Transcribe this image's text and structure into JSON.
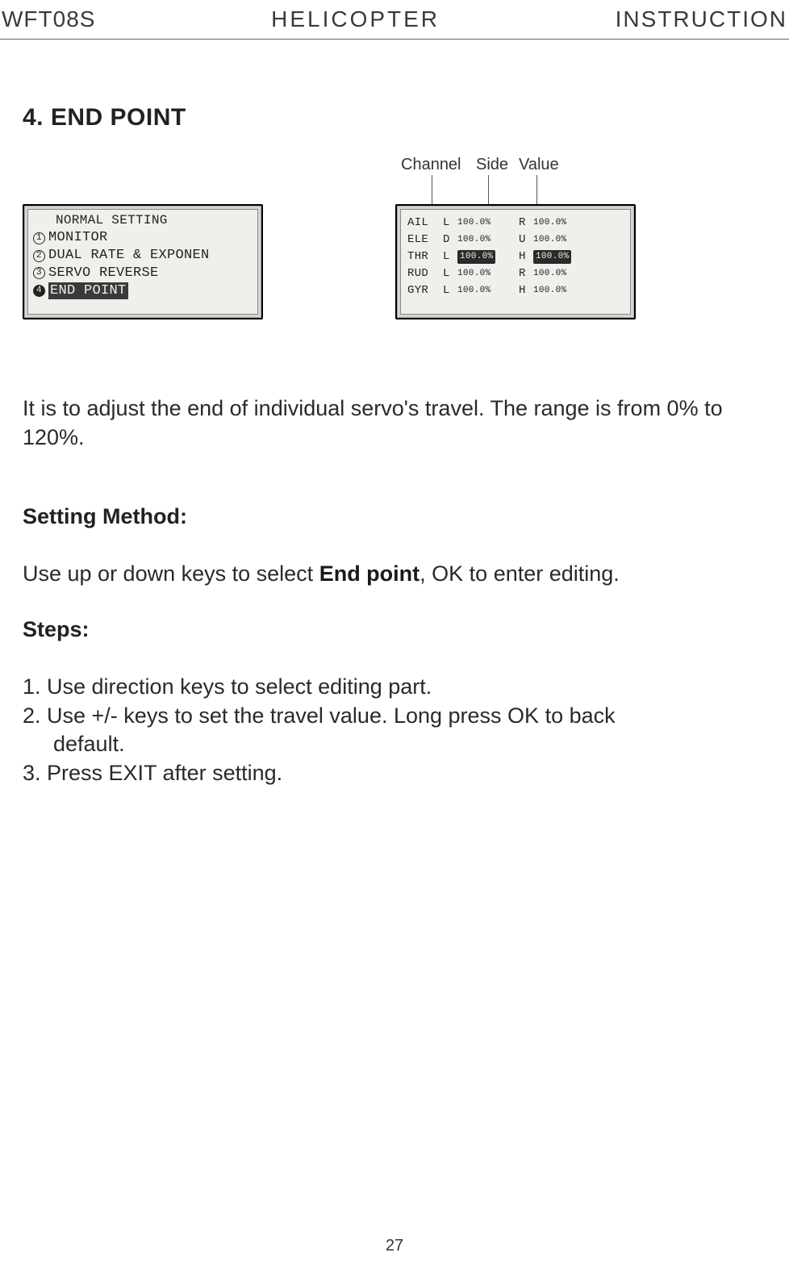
{
  "header": {
    "left": "WFT08S",
    "center": "HELICOPTER",
    "right": "INSTRUCTION"
  },
  "section_title": "4. END POINT",
  "callouts": {
    "channel": "Channel",
    "side": "Side",
    "value": "Value"
  },
  "lcd_menu": {
    "title": "NORMAL SETTING",
    "items": [
      {
        "num": "1",
        "label": "MONITOR"
      },
      {
        "num": "2",
        "label": "DUAL RATE & EXPONEN"
      },
      {
        "num": "3",
        "label": "SERVO REVERSE"
      },
      {
        "num": "4",
        "label": "END POINT",
        "selected": true
      }
    ]
  },
  "endpoint_table": {
    "rows": [
      {
        "ch": "AIL",
        "s1": "L",
        "v1": "100.0%",
        "s2": "R",
        "v2": "100.0%",
        "hl": false
      },
      {
        "ch": "ELE",
        "s1": "D",
        "v1": "100.0%",
        "s2": "U",
        "v2": "100.0%",
        "hl": false
      },
      {
        "ch": "THR",
        "s1": "L",
        "v1": "100.0%",
        "s2": "H",
        "v2": "100.0%",
        "hl": true
      },
      {
        "ch": "RUD",
        "s1": "L",
        "v1": "100.0%",
        "s2": "R",
        "v2": "100.0%",
        "hl": false
      },
      {
        "ch": "GYR",
        "s1": "L",
        "v1": "100.0%",
        "s2": "H",
        "v2": "100.0%",
        "hl": false
      }
    ]
  },
  "description": "It is to adjust  the end of individual servo's travel. The range is from 0% to 120%.",
  "setting_method_title": "Setting Method:",
  "setting_method_text_pre": "Use up or down keys to select ",
  "setting_method_text_bold": "End point",
  "setting_method_text_post": ", OK to enter editing.",
  "steps_title": "Steps:",
  "steps": {
    "s1": "1. Use direction keys to select editing part.",
    "s2": "2. Use +/- keys to set the travel value. Long press OK to back",
    "s2b": "default.",
    "s3": "3. Press EXIT after setting."
  },
  "page_number": "27"
}
